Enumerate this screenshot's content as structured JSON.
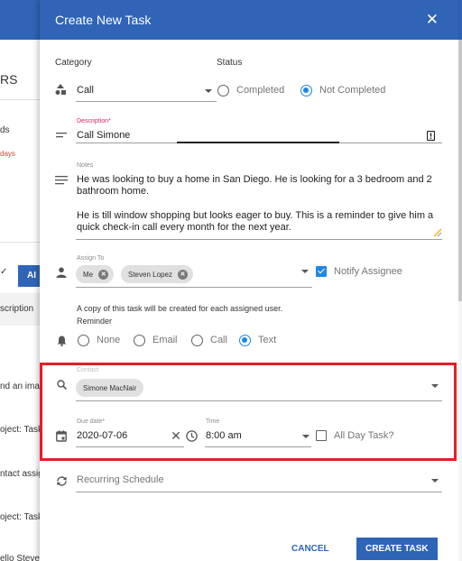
{
  "background": {
    "heading": "RS",
    "line1": "ds",
    "line2_red": "days",
    "button_label": "AI",
    "column_header": "scription",
    "rows": [
      "nd an imag",
      "oject: Task",
      "ntact assig",
      "oject: Task",
      "ello Steven"
    ]
  },
  "dialog": {
    "title": "Create New Task",
    "category": {
      "label": "Category",
      "value": "Call"
    },
    "status": {
      "label": "Status",
      "options": [
        "Completed",
        "Not Completed"
      ],
      "selected": "Not Completed"
    },
    "description": {
      "label": "Description*",
      "value": "Call Simone"
    },
    "notes": {
      "label": "Notes",
      "paragraph1": "He was looking to buy a home in San Diego. He is looking for a 3 bedroom and 2 bathroom home.",
      "paragraph2": "He is till window shopping but looks eager to buy. This is a reminder to give him a quick check-in call every month for the next year."
    },
    "assign_to": {
      "label": "Assign To",
      "chips": [
        "Me",
        "Steven Lopez"
      ],
      "notify_label": "Notify Assignee",
      "notify_checked": true,
      "copy_note": "A copy of this task will be created for each assigned user."
    },
    "reminder": {
      "label": "Reminder",
      "options": [
        "None",
        "Email",
        "Call",
        "Text"
      ],
      "selected": "Text"
    },
    "contact": {
      "label": "Contact",
      "chip": "Simone MacNair"
    },
    "due_date": {
      "label": "Due date*",
      "value": "2020-07-06"
    },
    "time": {
      "label": "Time",
      "value": "8:00 am"
    },
    "all_day": {
      "label": "All Day Task?",
      "checked": false
    },
    "recurring": {
      "placeholder": "Recurring Schedule"
    },
    "footer": {
      "cancel": "CANCEL",
      "create": "CREATE TASK"
    }
  },
  "colors": {
    "accent": "#2f64b7",
    "radio_selected": "#1e88e5",
    "highlight": "#e41e26"
  },
  "icons": [
    "close-icon",
    "category-icon",
    "description-icon",
    "notes-icon",
    "person-icon",
    "bell-icon",
    "search-icon",
    "calendar-icon",
    "clock-icon",
    "recurring-icon",
    "clear-icon"
  ]
}
